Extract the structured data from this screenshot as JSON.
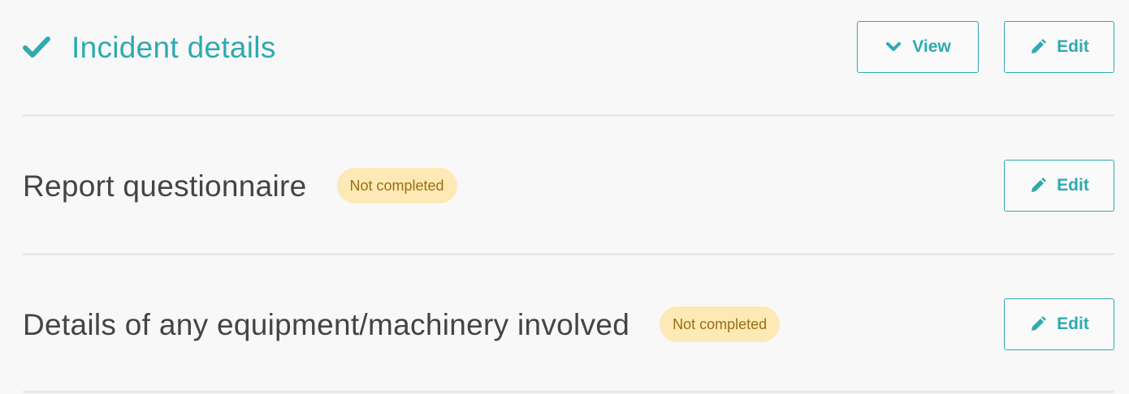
{
  "colors": {
    "accent": "#2eaab0",
    "text": "#444444",
    "badge_bg": "#fde9b5",
    "badge_text": "#9a6e12",
    "divider": "#e9e9e9",
    "background": "#f8f8f8"
  },
  "sections": [
    {
      "title": "Incident details",
      "status": "complete",
      "status_icon": "check-icon",
      "view_label": "View",
      "view_icon": "chevron-down-icon",
      "edit_label": "Edit",
      "edit_icon": "pencil-icon"
    },
    {
      "title": "Report questionnaire",
      "status": "not-completed",
      "badge": "Not completed",
      "edit_label": "Edit",
      "edit_icon": "pencil-icon"
    },
    {
      "title": "Details of any equipment/machinery involved",
      "status": "not-completed",
      "badge": "Not completed",
      "edit_label": "Edit",
      "edit_icon": "pencil-icon"
    }
  ]
}
